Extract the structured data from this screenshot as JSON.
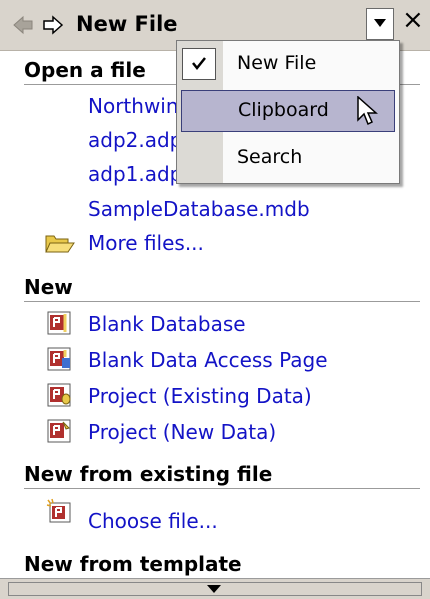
{
  "taskpane": {
    "title": "New File",
    "close_glyph": "×"
  },
  "open_section": {
    "heading": "Open a file",
    "files": [
      "Northwind.adp",
      "adp2.adp",
      "adp1.adp",
      "SampleDatabase.mdb"
    ],
    "more_files": "More files..."
  },
  "new_section": {
    "heading": "New",
    "items": [
      {
        "label": "Blank Database",
        "icon": "blank-database-icon"
      },
      {
        "label": "Blank Data Access Page",
        "icon": "data-access-page-icon"
      },
      {
        "label": "Project (Existing Data)",
        "icon": "project-existing-icon"
      },
      {
        "label": "Project (New Data)",
        "icon": "project-new-icon"
      }
    ]
  },
  "existing_section": {
    "heading": "New from existing file",
    "choose_file": "Choose file..."
  },
  "template_section": {
    "heading": "New from template"
  },
  "dropdown_menu": {
    "items": [
      {
        "label": "New File",
        "checked": true
      },
      {
        "label": "Clipboard",
        "highlighted": true
      },
      {
        "label": "Search"
      }
    ]
  },
  "colors": {
    "link": "#1313c6",
    "titlebar": "#d9d4cc",
    "menu_highlight": "#b7b5cf"
  }
}
